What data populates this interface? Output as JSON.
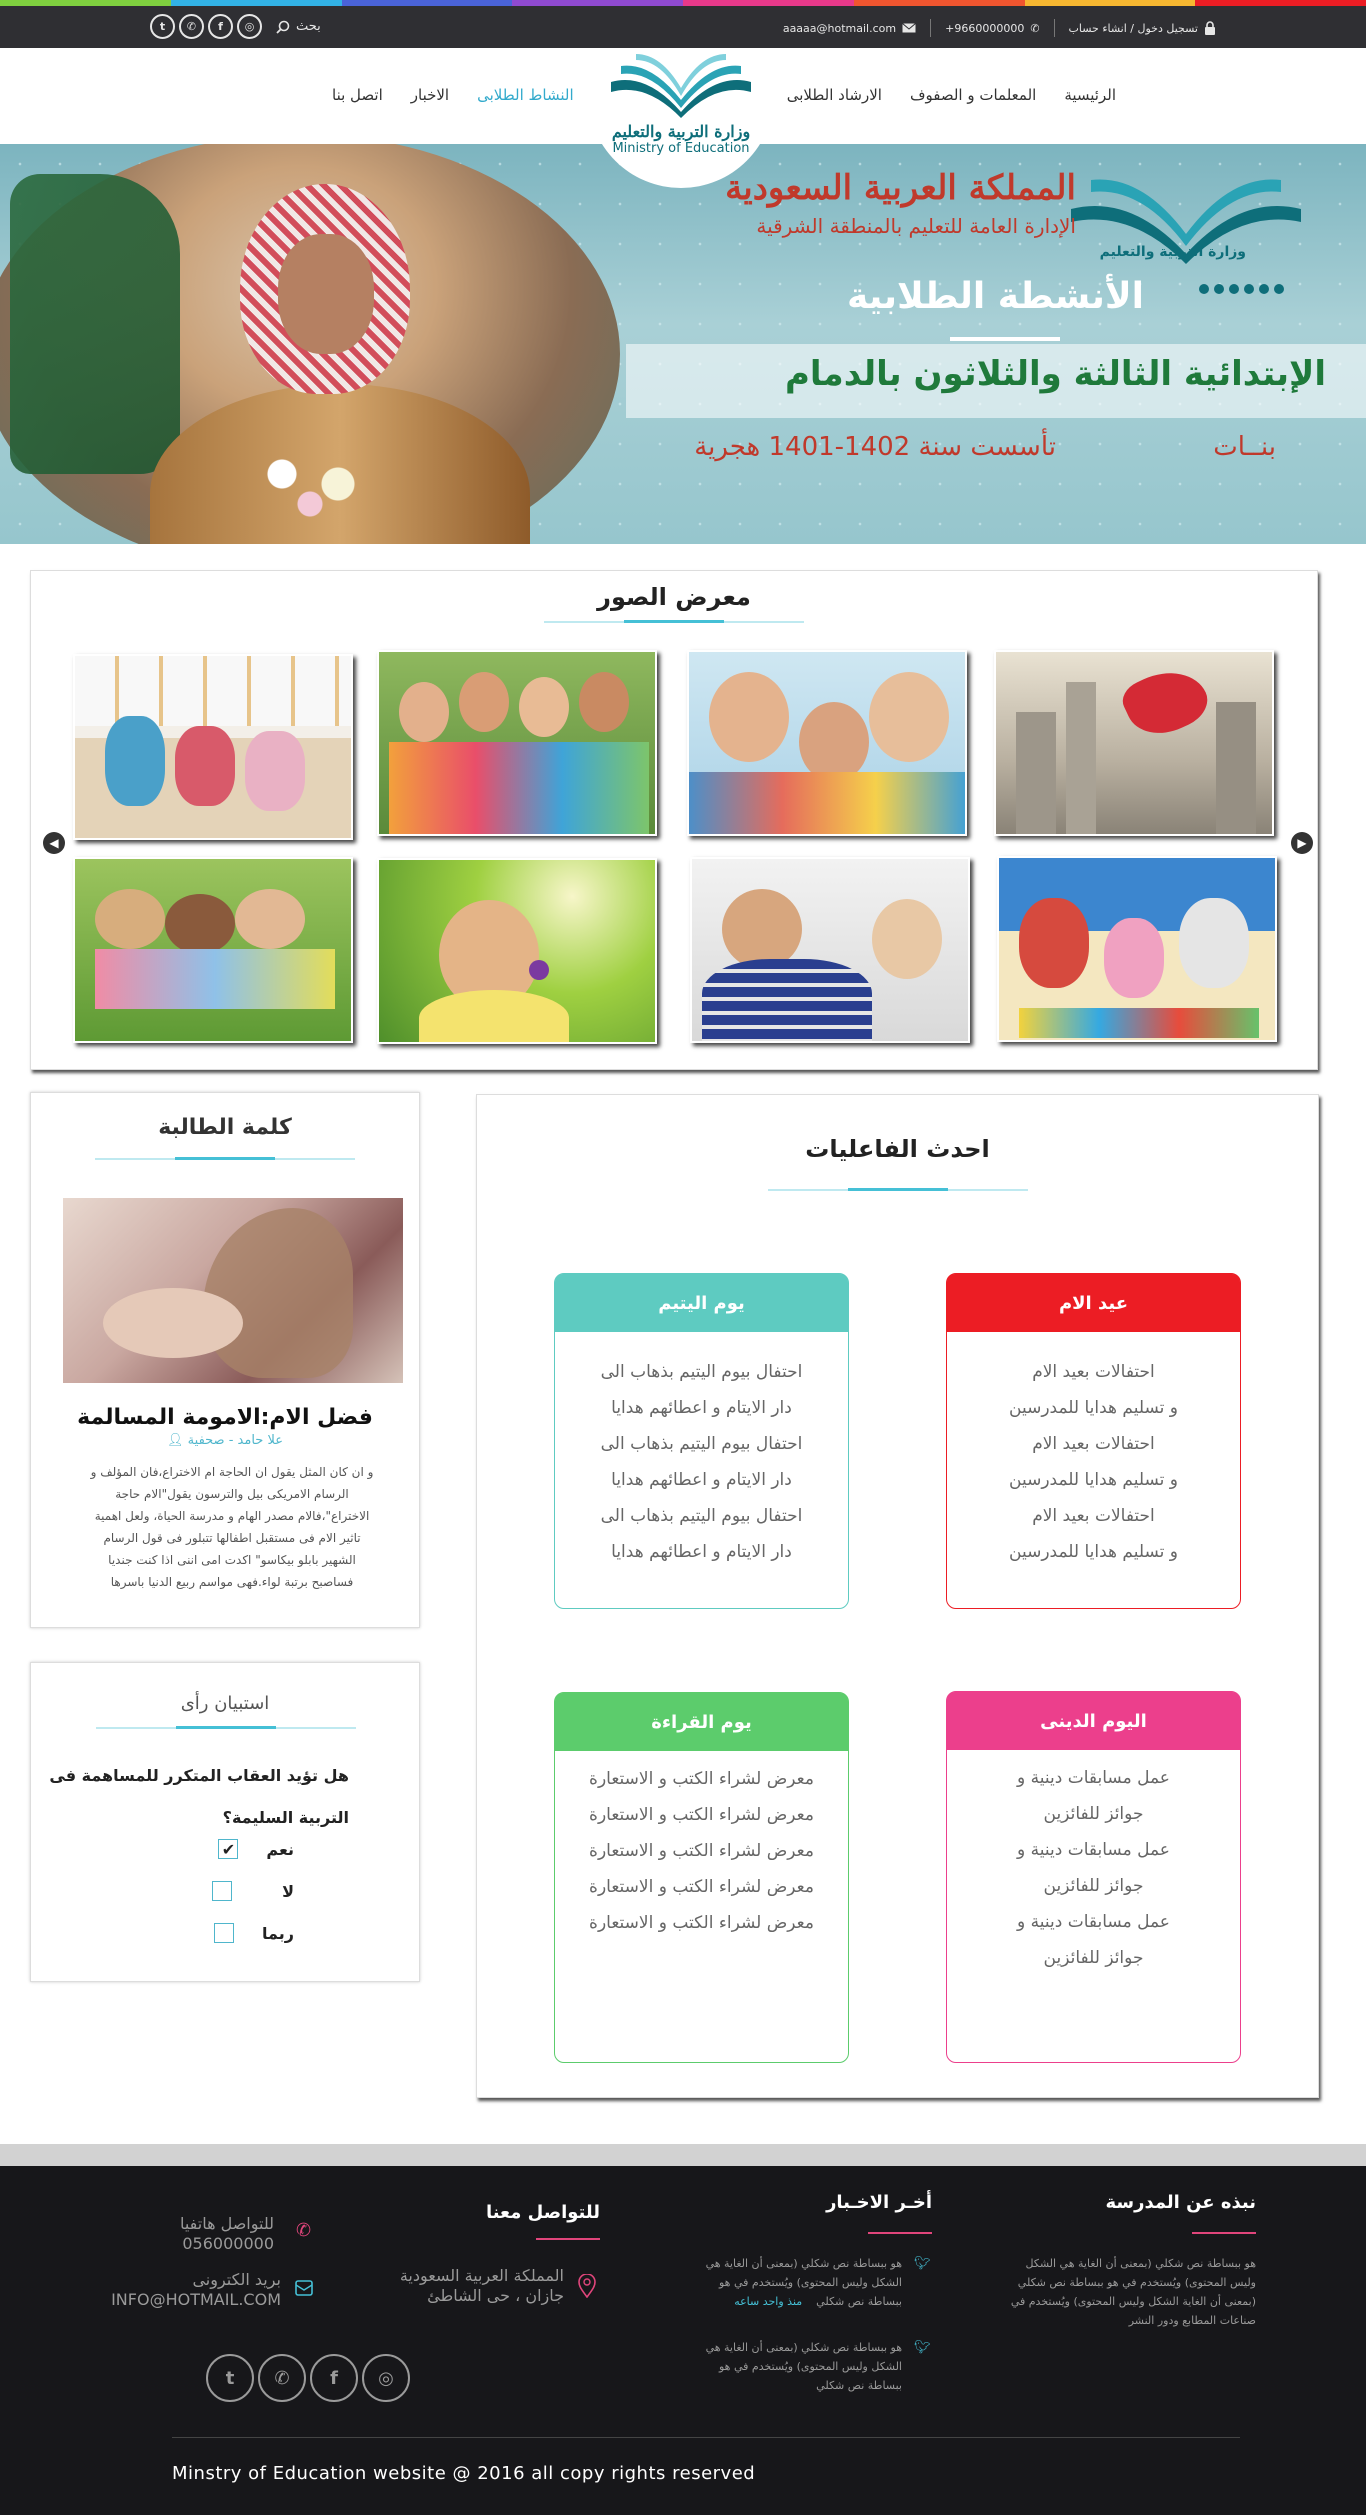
{
  "topbar": {
    "search_label": "بحث",
    "login_text": "تسجيل دخول / انشاء حساب",
    "phone": "+9660000000",
    "email": "aaaaa@hotmail.com",
    "social": [
      "instagram-icon",
      "facebook-icon",
      "whatsapp-icon",
      "twitter-icon"
    ]
  },
  "nav": {
    "right_items": [
      "الرئيسية",
      "المعلمات و الصفوف",
      "الارشاد الطلابى"
    ],
    "left_items": [
      "النشاط الطلابى",
      "الاخبار",
      "اتصل بنا"
    ],
    "active": "النشاط الطلابى",
    "logo_ar": "وزارة التربية والتعليم",
    "logo_en": "Ministry of Education"
  },
  "banner": {
    "title1": "المملكة العربية السعودية",
    "title2": "الإدارة العامة للتعليم بالمنطقة الشرقية",
    "activity": "الأنشطة الطلابية",
    "school": "الإبتدائية الثالثة والثلاثون بالدمام",
    "girls": "بنــات",
    "founded": "تأسست سنة 1402-1401 هجرية",
    "logo_text": "وزارة التربية والتعليم"
  },
  "gallery": {
    "title": "معرض الصور",
    "prev_label": "◀",
    "next_label": "▶"
  },
  "quote": {
    "title": "كلمة الطالبة",
    "heading": "فضل الام:الامومة المسالمة",
    "author": "علا حامد - صحفية",
    "lines": [
      "و ان كان المثل يقول ان الحاجة ام الاختراع،فان المؤلف و",
      "الرسام الامريكى بيل والترسون يقول\"الام حاجة",
      "الاختراع\"،فالام مصدر الهام و مدرسة الحياة، ولعل اهمية",
      "تاثير الام فى مستقبل اطفالها تتبلور فى قول الرسام",
      "الشهير بابلو بيكاسو\" اكدت امى اننى اذا كنت جنديا",
      "فساصبح برتبة لواء.فهى مواسم ربيع الدنيا باسرها"
    ]
  },
  "poll": {
    "title": "استبيان رأى",
    "question": "هل تؤيد العقاب المتكرر للمساهمة فى التربية السليمة؟",
    "options": [
      {
        "label": "نعم",
        "checked": true
      },
      {
        "label": "لا",
        "checked": false
      },
      {
        "label": "ربما",
        "checked": false
      }
    ]
  },
  "activities": {
    "title": "احدث الفاعليات",
    "items": [
      {
        "name": "عيد الام",
        "color": "#ec1d24",
        "lines": [
          "احتفالات بعيد الام",
          "و تسليم هدايا للمدرسين",
          "احتفالات بعيد الام",
          "و تسليم هدايا للمدرسين",
          "احتفالات بعيد الام",
          "و تسليم هدايا للمدرسين"
        ]
      },
      {
        "name": "يوم اليتيم",
        "color": "#5ecbc1",
        "lines": [
          "احتفال بيوم اليتيم بذهاب الى",
          "دار الايتام و اعطائهم هدايا",
          "احتفال بيوم اليتيم بذهاب الى",
          "دار الايتام و اعطائهم هدايا",
          "احتفال بيوم اليتيم بذهاب الى",
          "دار الايتام و اعطائهم هدايا"
        ]
      },
      {
        "name": "اليوم الدينى",
        "color": "#ec3f8c",
        "lines": [
          "عمل مسابقات دينية و",
          "جوائز للفائزين",
          "عمل مسابقات دينية و",
          "جوائز للفائزين",
          "عمل مسابقات دينية و",
          "جوائز للفائزين"
        ]
      },
      {
        "name": "يوم القراءة",
        "color": "#5ccc6c",
        "lines": [
          "معرض لشراء الكتب و الاستعارة",
          "معرض لشراء الكتب و الاستعارة",
          "معرض لشراء الكتب و الاستعارة",
          "معرض لشراء الكتب و الاستعارة",
          "معرض لشراء الكتب و الاستعارة"
        ]
      }
    ]
  },
  "footer": {
    "about_title": "نبذه عن المدرسة",
    "about_lines": [
      "هو ببساطة نص شكلي (بمعنى أن الغاية هي الشكل",
      "وليس المحتوى) ويُستخدم في هو ببساطة نص شكلي",
      "(بمعنى أن الغاية الشكل وليس المحتوى) ويُستخدم في",
      "صناعات المطابع ودور النشر"
    ],
    "news_title": "أخـر الاخـبار",
    "news1_lines": [
      "هو ببساطة نص شكلي (بمعنى أن الغاية هي",
      "الشكل وليس المحتوى) ويُستخدم في هو",
      "ببساطة نص شكلي"
    ],
    "news1_time": "منذ واحد ساعه",
    "news2_lines": [
      "هو ببساطة نص شكلي (بمعنى أن الغاية هي",
      "الشكل وليس المحتوى) ويُستخدم في هو",
      "ببساطة نص شكلي"
    ],
    "contact_title": "للتواصل معنا",
    "address_line1": "المملكة العربية السعودية",
    "address_line2": "جازان  ، حى الشاطئ",
    "phone_label": "للتواصل هاتفيا",
    "phone_value": "056000000",
    "email_label": "بريد الكترونى",
    "email_value": "INFO@HOTMAIL.COM",
    "copyright": "Minstry of Education website @ 2016  all copy rights reserved"
  }
}
